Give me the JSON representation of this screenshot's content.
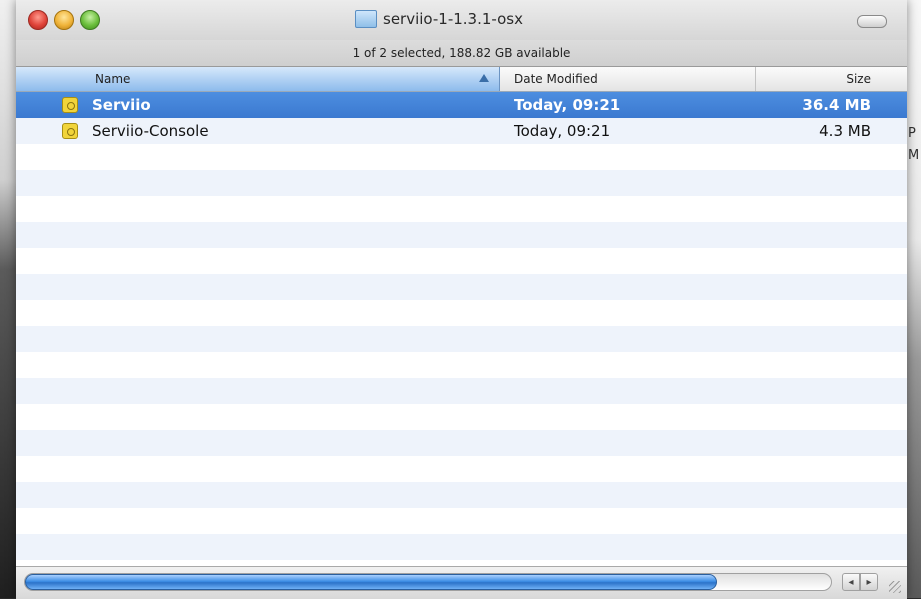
{
  "window": {
    "title": "serviio-1-1.3.1-osx",
    "status": "1 of 2 selected, 188.82 GB available"
  },
  "columns": {
    "name": "Name",
    "date": "Date Modified",
    "size": "Size"
  },
  "files": [
    {
      "name": "Serviio",
      "date": "Today, 09:21",
      "size": "36.4 MB",
      "selected": true
    },
    {
      "name": "Serviio-Console",
      "date": "Today, 09:21",
      "size": "4.3 MB",
      "selected": false
    }
  ],
  "desktop": {
    "peek_1": "P",
    "peek_2": "M"
  },
  "scroll": {
    "left": "◂",
    "right": "▸"
  },
  "icons": {
    "window_title": "folder-icon",
    "file": "app-icon",
    "sort": "sort-ascending-icon"
  },
  "colors": {
    "selection": "#3b79d0",
    "stripe": "#eef3fb",
    "app_icon": "#f1d43a"
  }
}
